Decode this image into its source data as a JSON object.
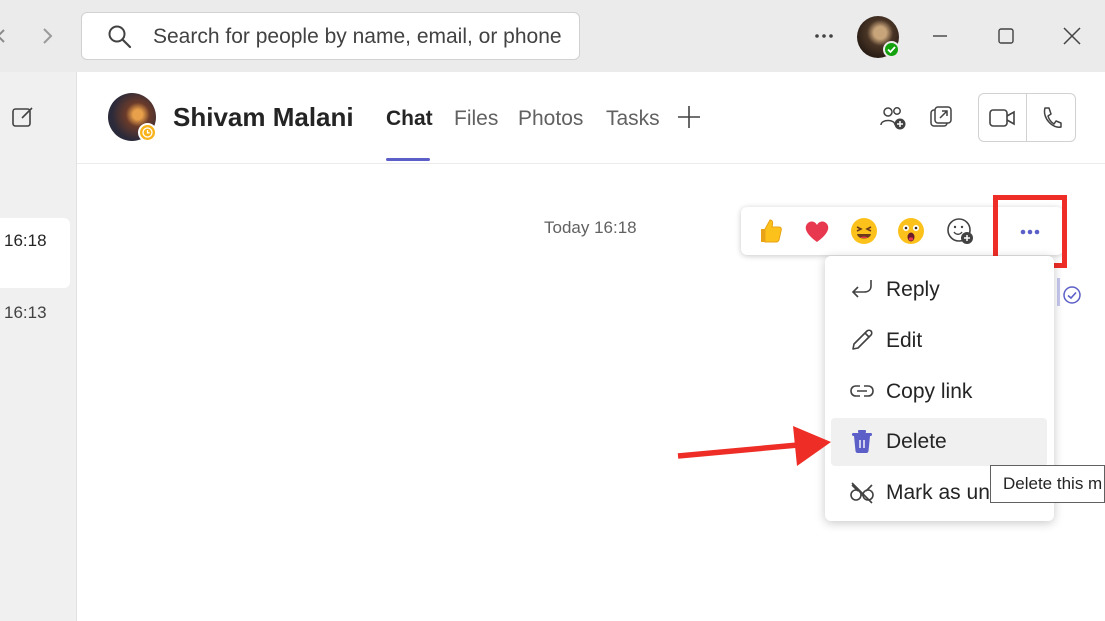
{
  "search": {
    "placeholder": "Search for people by name, email, or phone"
  },
  "chat_list": {
    "times": [
      "16:18",
      "16:13"
    ]
  },
  "header": {
    "contact_name": "Shivam Malani",
    "tabs": [
      {
        "label": "Chat",
        "active": true
      },
      {
        "label": "Files"
      },
      {
        "label": "Photos"
      },
      {
        "label": "Tasks"
      }
    ]
  },
  "messages": {
    "timestamp": "Today 16:18"
  },
  "reactions": [
    "thumbs-up",
    "heart",
    "laugh",
    "surprised",
    "add-reaction"
  ],
  "context_menu": {
    "items": [
      {
        "label": "Reply",
        "icon": "reply-icon"
      },
      {
        "label": "Edit",
        "icon": "pencil-icon"
      },
      {
        "label": "Copy link",
        "icon": "link-icon"
      },
      {
        "label": "Delete",
        "icon": "trash-icon",
        "hovered": true
      },
      {
        "label": "Mark as un",
        "icon": "mark-unread-icon"
      }
    ]
  },
  "tooltip": {
    "text": "Delete this m"
  },
  "colors": {
    "accent": "#5b5fc7",
    "annotation_red": "#ee2d27",
    "available_green": "#13a10e",
    "away_yellow": "#f8b21a"
  }
}
